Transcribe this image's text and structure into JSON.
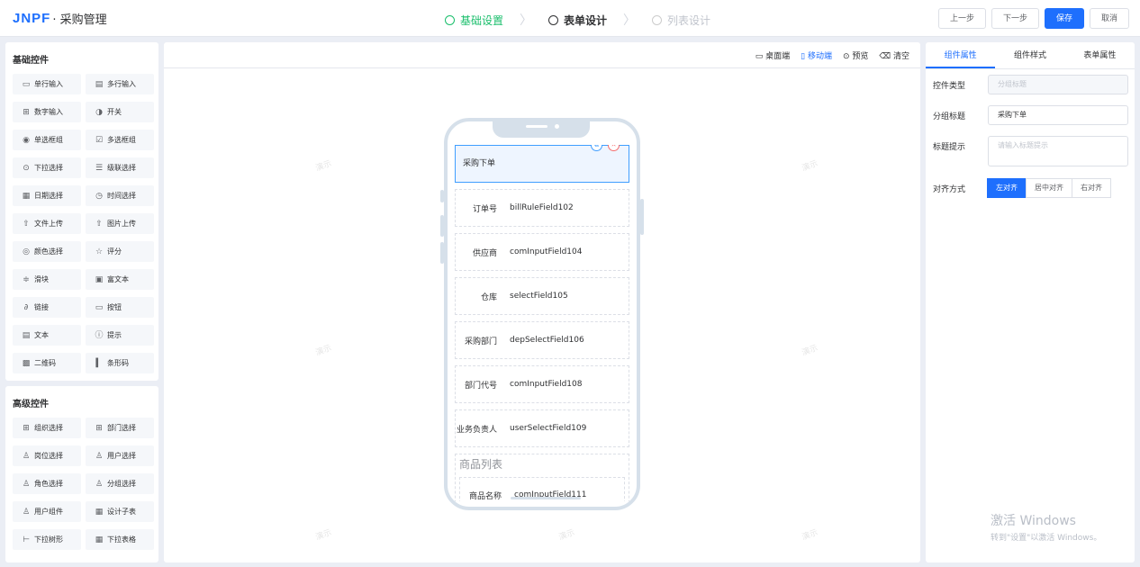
{
  "header": {
    "logo": "JNPF",
    "title": "· 采购管理",
    "steps": [
      {
        "label": "基础设置"
      },
      {
        "label": "表单设计"
      },
      {
        "label": "列表设计"
      }
    ],
    "buttons": {
      "prev": "上一步",
      "next": "下一步",
      "save": "保存",
      "cancel": "取消"
    }
  },
  "basic": {
    "title": "基础控件",
    "items": [
      {
        "icon": "▭",
        "label": "单行输入"
      },
      {
        "icon": "▤",
        "label": "多行输入"
      },
      {
        "icon": "⊞",
        "label": "数字输入"
      },
      {
        "icon": "◑",
        "label": "开关"
      },
      {
        "icon": "◉",
        "label": "单选框组"
      },
      {
        "icon": "☑",
        "label": "多选框组"
      },
      {
        "icon": "⊙",
        "label": "下拉选择"
      },
      {
        "icon": "☰",
        "label": "级联选择"
      },
      {
        "icon": "▦",
        "label": "日期选择"
      },
      {
        "icon": "◷",
        "label": "时间选择"
      },
      {
        "icon": "⇧",
        "label": "文件上传"
      },
      {
        "icon": "⇧",
        "label": "图片上传"
      },
      {
        "icon": "◎",
        "label": "颜色选择"
      },
      {
        "icon": "☆",
        "label": "评分"
      },
      {
        "icon": "≑",
        "label": "滑块"
      },
      {
        "icon": "▣",
        "label": "富文本"
      },
      {
        "icon": "∂",
        "label": "链接"
      },
      {
        "icon": "▭",
        "label": "按钮"
      },
      {
        "icon": "▤",
        "label": "文本"
      },
      {
        "icon": "ⓘ",
        "label": "提示"
      },
      {
        "icon": "▩",
        "label": "二维码"
      },
      {
        "icon": "▍",
        "label": "条形码"
      }
    ]
  },
  "advanced": {
    "title": "高级控件",
    "items": [
      {
        "icon": "⊞",
        "label": "组织选择"
      },
      {
        "icon": "⊞",
        "label": "部门选择"
      },
      {
        "icon": "♙",
        "label": "岗位选择"
      },
      {
        "icon": "♙",
        "label": "用户选择"
      },
      {
        "icon": "♙",
        "label": "角色选择"
      },
      {
        "icon": "♙",
        "label": "分组选择"
      },
      {
        "icon": "♙",
        "label": "用户组件"
      },
      {
        "icon": "▦",
        "label": "设计子表"
      },
      {
        "icon": "⊢",
        "label": "下拉树形"
      },
      {
        "icon": "▦",
        "label": "下拉表格"
      }
    ]
  },
  "canvas": {
    "tools": {
      "desktop": "桌面端",
      "mobile": "移动端",
      "preview": "预览",
      "clear": "清空"
    },
    "watermark": "演示",
    "selected": "采购下单",
    "fields": [
      {
        "label": "订单号",
        "value": "billRuleField102"
      },
      {
        "label": "供应商",
        "value": "comInputField104"
      },
      {
        "label": "仓库",
        "value": "selectField105"
      },
      {
        "label": "采购部门",
        "value": "depSelectField106"
      },
      {
        "label": "部门代号",
        "value": "comInputField108"
      },
      {
        "label": "业务负责人",
        "value": "userSelectField109"
      }
    ],
    "group": {
      "title": "商品列表",
      "label": "商品名称",
      "value": "comInputField111"
    }
  },
  "props": {
    "tabs": [
      "组件属性",
      "组件样式",
      "表单属性"
    ],
    "rows": {
      "type_label": "控件类型",
      "type_value": "分组标题",
      "title_label": "分组标题",
      "title_value": "采购下单",
      "hint_label": "标题提示",
      "hint_placeholder": "请输入标题提示",
      "align_label": "对齐方式",
      "align_options": [
        "左对齐",
        "居中对齐",
        "右对齐"
      ]
    }
  },
  "windows": {
    "line1": "激活 Windows",
    "line2": "转到\"设置\"以激活 Windows。"
  }
}
